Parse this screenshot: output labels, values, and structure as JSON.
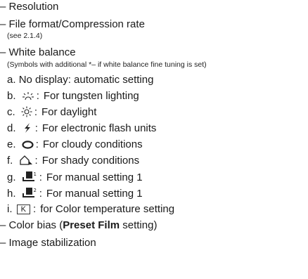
{
  "items": {
    "resolution": "– Resolution",
    "file_format": "– File format/Compression rate",
    "file_format_note": "(see 2.1.4)",
    "white_balance": "– White balance",
    "white_balance_note": "(Symbols with additional *– if white balance fine tuning is set)",
    "color_bias_prefix": "– Color bias (",
    "color_bias_bold": "Preset Film",
    "color_bias_suffix": " setting)",
    "image_stabilization": "– Image stabilization"
  },
  "wb_options": [
    {
      "letter": "a.",
      "text": "No display: automatic setting",
      "icon": ""
    },
    {
      "letter": "b.",
      "text": "For tungsten lighting",
      "icon": "tungsten-icon"
    },
    {
      "letter": "c.",
      "text": "For daylight",
      "icon": "sun-icon"
    },
    {
      "letter": "d.",
      "text": "For electronic flash units",
      "icon": "flash-icon"
    },
    {
      "letter": "e.",
      "text": "For cloudy conditions",
      "icon": "cloud-icon"
    },
    {
      "letter": "f.",
      "text": "For shady conditions",
      "icon": "shade-icon"
    },
    {
      "letter": "g.",
      "text": "For manual setting 1",
      "icon": "manual-1-icon",
      "sup": "1"
    },
    {
      "letter": "h.",
      "text": "For manual setting 1",
      "icon": "manual-2-icon",
      "sup": "2"
    },
    {
      "letter": "i.",
      "text": "for Color temperature setting",
      "icon": "kelvin-icon",
      "box": "K"
    }
  ],
  "separator": ":"
}
